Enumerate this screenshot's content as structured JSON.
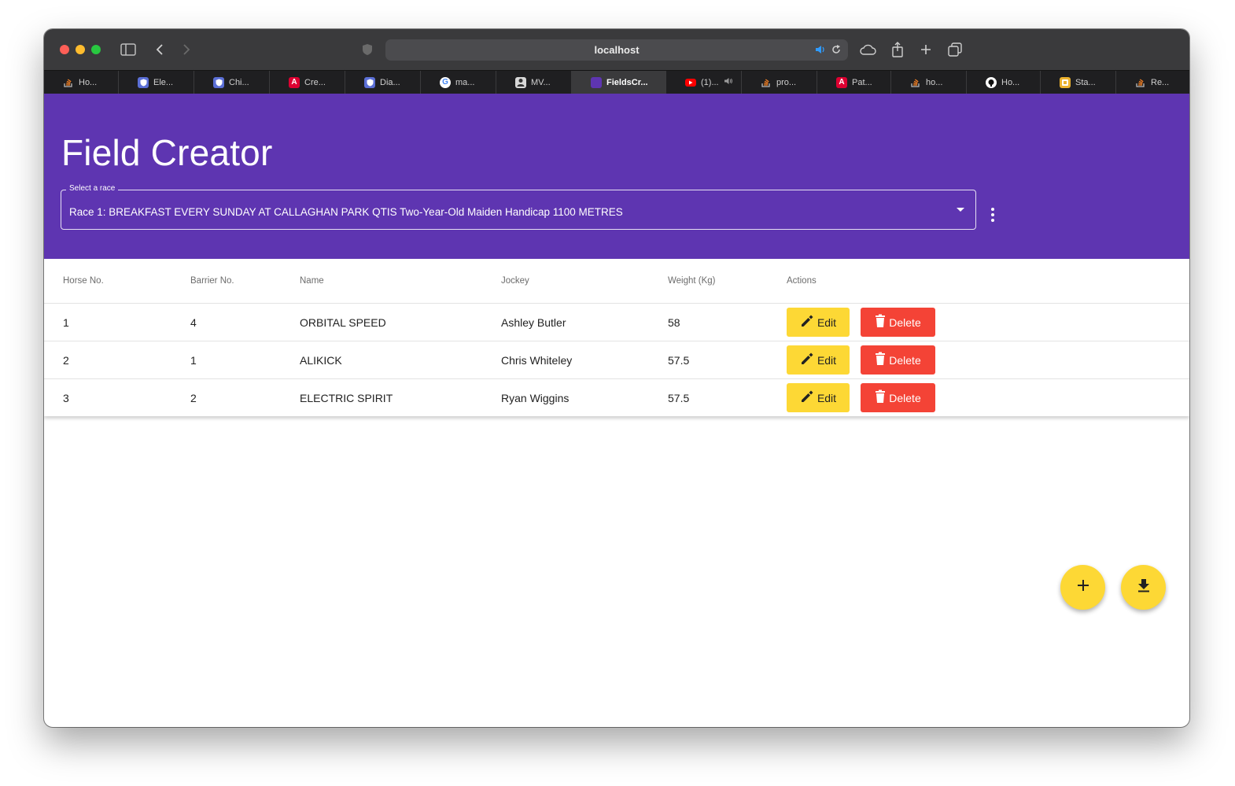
{
  "browser": {
    "url": "localhost",
    "tabs": [
      {
        "label": "Ho...",
        "icon": "stackoverflow-icon",
        "color": "#f48024"
      },
      {
        "label": "Ele...",
        "icon": "shield-app-icon",
        "color": "#5b6fd6"
      },
      {
        "label": "Chi...",
        "icon": "shield-app-icon",
        "color": "#5b6fd6"
      },
      {
        "label": "Cre...",
        "icon": "angular-icon",
        "color": "#dd0031"
      },
      {
        "label": "Dia...",
        "icon": "shield-app-icon",
        "color": "#5b6fd6"
      },
      {
        "label": "ma...",
        "icon": "google-icon",
        "color": "#4285f4"
      },
      {
        "label": "MV...",
        "icon": "avatar-icon",
        "color": "#cccccc"
      },
      {
        "label": "FieldsCr...",
        "icon": "app-icon",
        "color": "#5e35b1"
      },
      {
        "label": "(1)...",
        "icon": "youtube-icon",
        "color": "#ff0000"
      },
      {
        "label": "pro...",
        "icon": "stackoverflow-icon",
        "color": "#f48024"
      },
      {
        "label": "Pat...",
        "icon": "angular-icon",
        "color": "#dd0031"
      },
      {
        "label": "ho...",
        "icon": "stackoverflow-icon",
        "color": "#f48024"
      },
      {
        "label": "Ho...",
        "icon": "github-icon",
        "color": "#ffffff"
      },
      {
        "label": "Sta...",
        "icon": "slack-icon",
        "color": "#ecb22e"
      },
      {
        "label": "Re...",
        "icon": "stackoverflow-icon",
        "color": "#f48024"
      }
    ]
  },
  "header": {
    "title": "Field Creator",
    "select_label": "Select a race",
    "select_value": "Race 1: BREAKFAST EVERY SUNDAY AT CALLAGHAN PARK QTIS Two-Year-Old Maiden Handicap 1100 METRES"
  },
  "table": {
    "columns": {
      "horse_no": "Horse No.",
      "barrier_no": "Barrier No.",
      "name": "Name",
      "jockey": "Jockey",
      "weight": "Weight (Kg)",
      "actions": "Actions"
    },
    "rows": [
      {
        "horse_no": "1",
        "barrier_no": "4",
        "name": "ORBITAL SPEED",
        "jockey": "Ashley Butler",
        "weight": "58"
      },
      {
        "horse_no": "2",
        "barrier_no": "1",
        "name": "ALIKICK",
        "jockey": "Chris Whiteley",
        "weight": "57.5"
      },
      {
        "horse_no": "3",
        "barrier_no": "2",
        "name": "ELECTRIC SPIRIT",
        "jockey": "Ryan Wiggins",
        "weight": "57.5"
      }
    ],
    "edit_label": "Edit",
    "delete_label": "Delete"
  },
  "colors": {
    "primary": "#5e35b1",
    "accent": "#fdd835",
    "warn": "#f44336"
  }
}
